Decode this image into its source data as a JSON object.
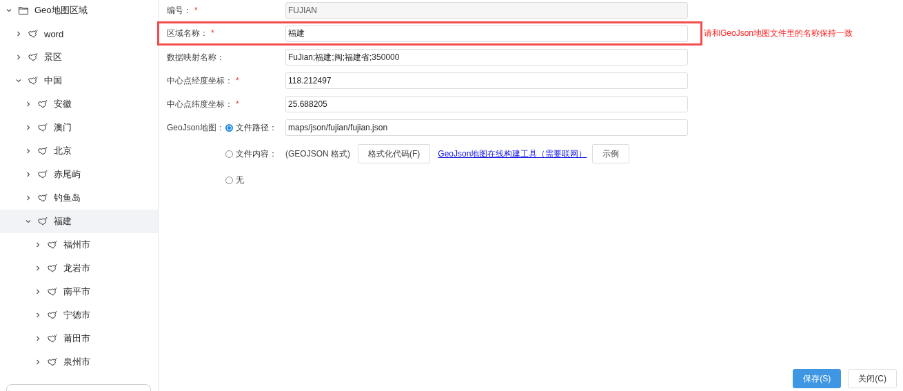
{
  "tree": {
    "label": "Geo地图区域",
    "kind": "folder",
    "expanded": true,
    "selected": false,
    "children": [
      {
        "label": "word",
        "kind": "map",
        "expanded": false,
        "selected": false
      },
      {
        "label": "景区",
        "kind": "map",
        "expanded": false,
        "selected": false
      },
      {
        "label": "中国",
        "kind": "map",
        "expanded": true,
        "selected": false,
        "children": [
          {
            "label": "安徽",
            "kind": "map",
            "expanded": false,
            "selected": false
          },
          {
            "label": "澳门",
            "kind": "map",
            "expanded": false,
            "selected": false
          },
          {
            "label": "北京",
            "kind": "map",
            "expanded": false,
            "selected": false
          },
          {
            "label": "赤尾屿",
            "kind": "map",
            "expanded": false,
            "selected": false
          },
          {
            "label": "钓鱼岛",
            "kind": "map",
            "expanded": false,
            "selected": false
          },
          {
            "label": "福建",
            "kind": "map",
            "expanded": true,
            "selected": true,
            "children": [
              {
                "label": "福州市",
                "kind": "map",
                "expanded": false,
                "selected": false
              },
              {
                "label": "龙岩市",
                "kind": "map",
                "expanded": false,
                "selected": false
              },
              {
                "label": "南平市",
                "kind": "map",
                "expanded": false,
                "selected": false
              },
              {
                "label": "宁德市",
                "kind": "map",
                "expanded": false,
                "selected": false
              },
              {
                "label": "莆田市",
                "kind": "map",
                "expanded": false,
                "selected": false
              },
              {
                "label": "泉州市",
                "kind": "map",
                "expanded": false,
                "selected": false
              }
            ]
          }
        ]
      }
    ]
  },
  "fields": [
    {
      "label": "编号：",
      "required": true,
      "value": "FUJIAN",
      "disabled": true,
      "highlighted": false
    },
    {
      "label": "区域名称：",
      "required": true,
      "value": "福建",
      "disabled": false,
      "highlighted": true,
      "hint": "请和GeoJson地图文件里的名称保持一致"
    },
    {
      "label": "数据映射名称：",
      "required": false,
      "value": "FuJian;福建;闽;福建省;350000",
      "disabled": false,
      "highlighted": false
    },
    {
      "label": "中心点经度坐标：",
      "required": true,
      "value": "118.212497",
      "disabled": false,
      "highlighted": false
    },
    {
      "label": "中心点纬度坐标：",
      "required": true,
      "value": "25.688205",
      "disabled": false,
      "highlighted": false
    }
  ],
  "required_mark": "*",
  "geojson": {
    "label": "GeoJson地图：",
    "options": [
      {
        "kind": "path",
        "label": "文件路径：",
        "selected": true,
        "value": "maps/json/fujian/fujian.json"
      },
      {
        "kind": "content",
        "label": "文件内容：",
        "selected": false,
        "note": "(GEOJSON 格式)",
        "format_button": "格式化代码(F)",
        "link": "GeoJson地图在线构建工具（需要联网）",
        "example_button": "示例"
      },
      {
        "kind": "none",
        "label": "无",
        "selected": false
      }
    ]
  },
  "footer_buttons": [
    {
      "label": "保存(S)",
      "kind": "primary"
    },
    {
      "label": "关闭(C)",
      "kind": "default"
    }
  ]
}
